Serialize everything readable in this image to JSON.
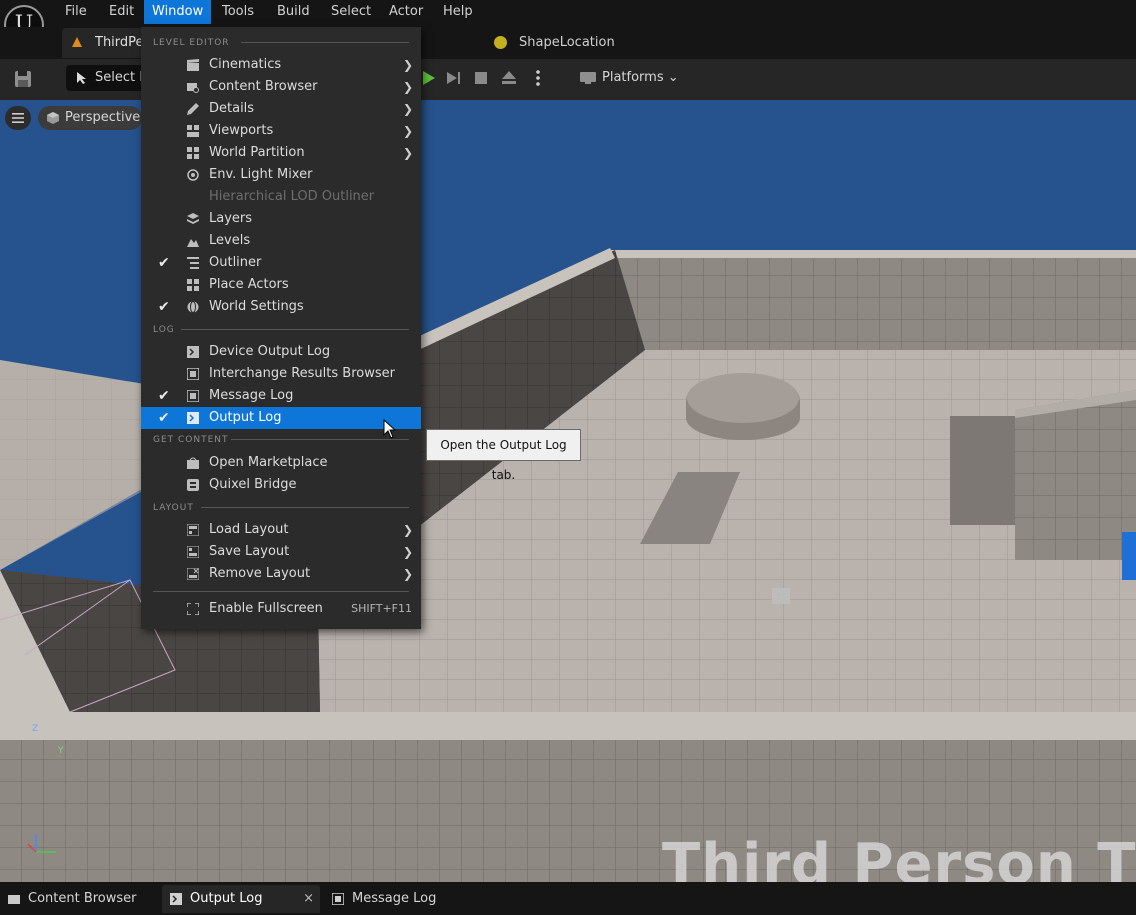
{
  "app": {
    "logo_char": "U"
  },
  "menubar": {
    "items": [
      {
        "label": "File"
      },
      {
        "label": "Edit"
      },
      {
        "label": "Window"
      },
      {
        "label": "Tools"
      },
      {
        "label": "Build"
      },
      {
        "label": "Select"
      },
      {
        "label": "Actor"
      },
      {
        "label": "Help"
      }
    ],
    "active": "Window"
  },
  "tabs": {
    "level_tab": "ThirdPe",
    "shape_location": "ShapeLocation"
  },
  "toolbar": {
    "mode_label": "Select M",
    "platforms_label": "Platforms"
  },
  "viewport": {
    "perspective_label": "Perspective",
    "overlay_text": "Third Person T",
    "axis_z": "Z",
    "axis_y": "Y"
  },
  "window_menu": {
    "sections": {
      "level_editor": "LEVEL EDITOR",
      "log": "LOG",
      "get_content": "GET CONTENT",
      "layout": "LAYOUT"
    },
    "level_editor": [
      {
        "label": "Cinematics",
        "submenu": true,
        "checked": false
      },
      {
        "label": "Content Browser",
        "submenu": true,
        "checked": false
      },
      {
        "label": "Details",
        "submenu": true,
        "checked": false
      },
      {
        "label": "Viewports",
        "submenu": true,
        "checked": false
      },
      {
        "label": "World Partition",
        "submenu": true,
        "checked": false
      },
      {
        "label": "Env. Light Mixer",
        "submenu": false,
        "checked": false
      },
      {
        "label": "Hierarchical LOD Outliner",
        "submenu": false,
        "checked": false,
        "disabled": true
      },
      {
        "label": "Layers",
        "submenu": false,
        "checked": false
      },
      {
        "label": "Levels",
        "submenu": false,
        "checked": false
      },
      {
        "label": "Outliner",
        "submenu": false,
        "checked": true
      },
      {
        "label": "Place Actors",
        "submenu": false,
        "checked": false
      },
      {
        "label": "World Settings",
        "submenu": false,
        "checked": true
      }
    ],
    "log": [
      {
        "label": "Device Output Log",
        "checked": false
      },
      {
        "label": "Interchange Results Browser",
        "checked": false
      },
      {
        "label": "Message Log",
        "checked": true
      },
      {
        "label": "Output Log",
        "checked": true,
        "highlighted": true
      }
    ],
    "get_content": [
      {
        "label": "Open Marketplace"
      },
      {
        "label": "Quixel Bridge"
      }
    ],
    "layout": [
      {
        "label": "Load Layout",
        "submenu": true
      },
      {
        "label": "Save Layout",
        "submenu": true
      },
      {
        "label": "Remove Layout",
        "submenu": true
      }
    ],
    "fullscreen": {
      "label": "Enable Fullscreen",
      "shortcut": "SHIFT+F11"
    }
  },
  "tooltip": {
    "text": "Open the Output Log tab."
  },
  "bottom_tabs": [
    {
      "label": "Content Browser"
    },
    {
      "label": "Output Log",
      "close": "×"
    },
    {
      "label": "Message Log"
    }
  ],
  "colors": {
    "accent": "#0e75d9",
    "menu_bg": "#2b2b2b",
    "sky": "#26528d"
  }
}
